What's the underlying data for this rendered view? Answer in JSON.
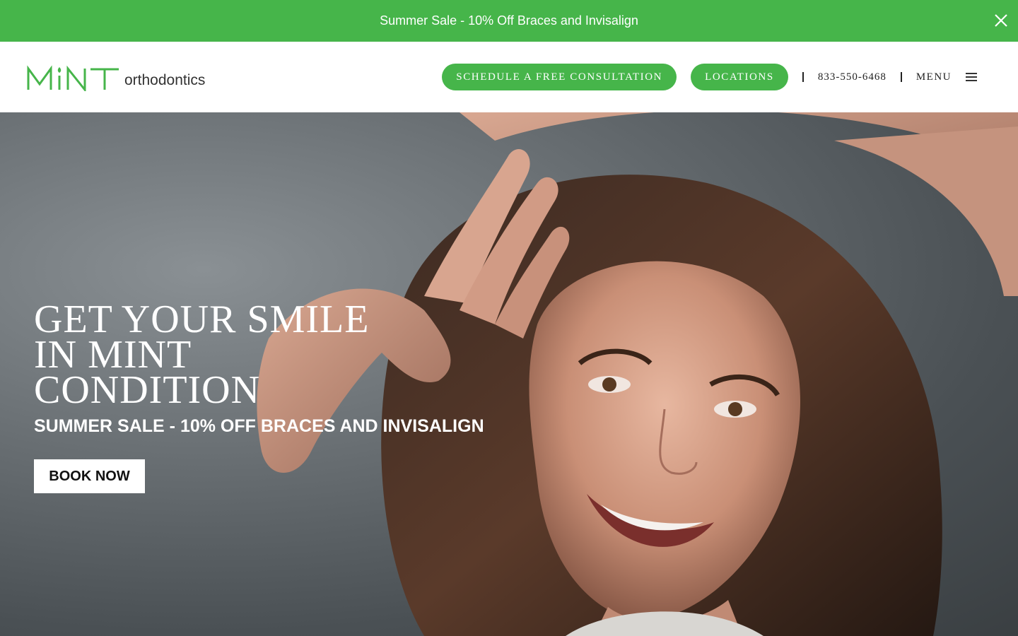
{
  "announcement": {
    "text": "Summer Sale - 10% Off Braces and Invisalign",
    "close_icon": "close-icon"
  },
  "header": {
    "logo_mark": "MINT",
    "logo_word": "orthodontics",
    "buttons": {
      "schedule": "SCHEDULE A FREE CONSULTATION",
      "locations": "LOCATIONS"
    },
    "phone": "833-550-6468",
    "menu_label": "MENU",
    "menu_icon": "hamburger-icon"
  },
  "hero": {
    "title": "GET YOUR SMILE\nIN MINT\nCONDITION",
    "subtitle": "SUMMER SALE - 10% OFF BRACES AND INVISALIGN",
    "cta": "BOOK NOW"
  },
  "colors": {
    "brand_green": "#46b54a",
    "text_dark": "#222222",
    "white": "#ffffff"
  }
}
